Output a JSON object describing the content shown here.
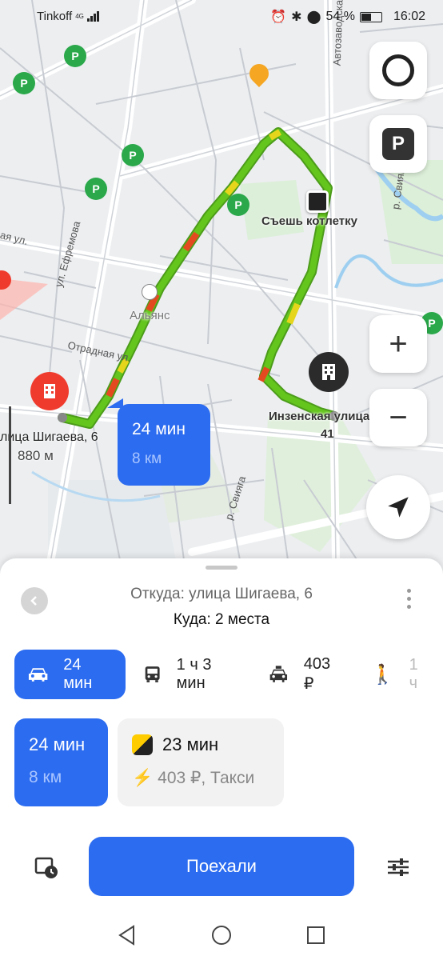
{
  "status_bar": {
    "carrier": "Tinkoff",
    "network": "4G",
    "battery": "54 %",
    "time": "16:02"
  },
  "map": {
    "labels": {
      "poi_restaurant": "Съешь котлетку",
      "poi_shop": "Альянс",
      "destination_address": "Инзенская улица",
      "destination_number": "41",
      "origin_address": "лица Шигаева, 6",
      "origin_distance": "880 м"
    },
    "streets": {
      "efremova": "ул. Ефремова",
      "otradnaya": "Отрадная ул.",
      "avtozavod": "Автозаводская",
      "svyaga": "р. Свияга",
      "svyaga2": "р. Свияга",
      "aya": "ая ул."
    },
    "route_bubble": {
      "time": "24 мин",
      "distance": "8 км"
    },
    "buttons": {
      "alice": "alice-icon",
      "parking": "P",
      "zoom_in": "+",
      "zoom_out": "−",
      "locate": "navigation-arrow-icon"
    }
  },
  "sheet": {
    "from": "Откуда: улица Шигаева, 6",
    "to": "Куда: 2 места",
    "modes": [
      {
        "icon": "car-icon",
        "label": "24 мин",
        "active": true
      },
      {
        "icon": "bus-icon",
        "label": "1 ч 3 мин",
        "active": false
      },
      {
        "icon": "taxi-icon",
        "label": "403 ₽",
        "active": false
      },
      {
        "icon": "walk-icon",
        "label": "1 ч",
        "active": false
      }
    ],
    "cards": {
      "primary": {
        "time": "24 мин",
        "distance": "8 км"
      },
      "taxi": {
        "time": "23 мин",
        "price": "403 ₽, Такси"
      }
    },
    "go_label": "Поехали"
  },
  "colors": {
    "accent": "#2c6cf0",
    "route_green": "#64c51d",
    "route_yellow": "#e5d51b",
    "route_red": "#e34a1f",
    "parking_green": "#2aa84a",
    "destination_red": "#ef3b2d"
  }
}
